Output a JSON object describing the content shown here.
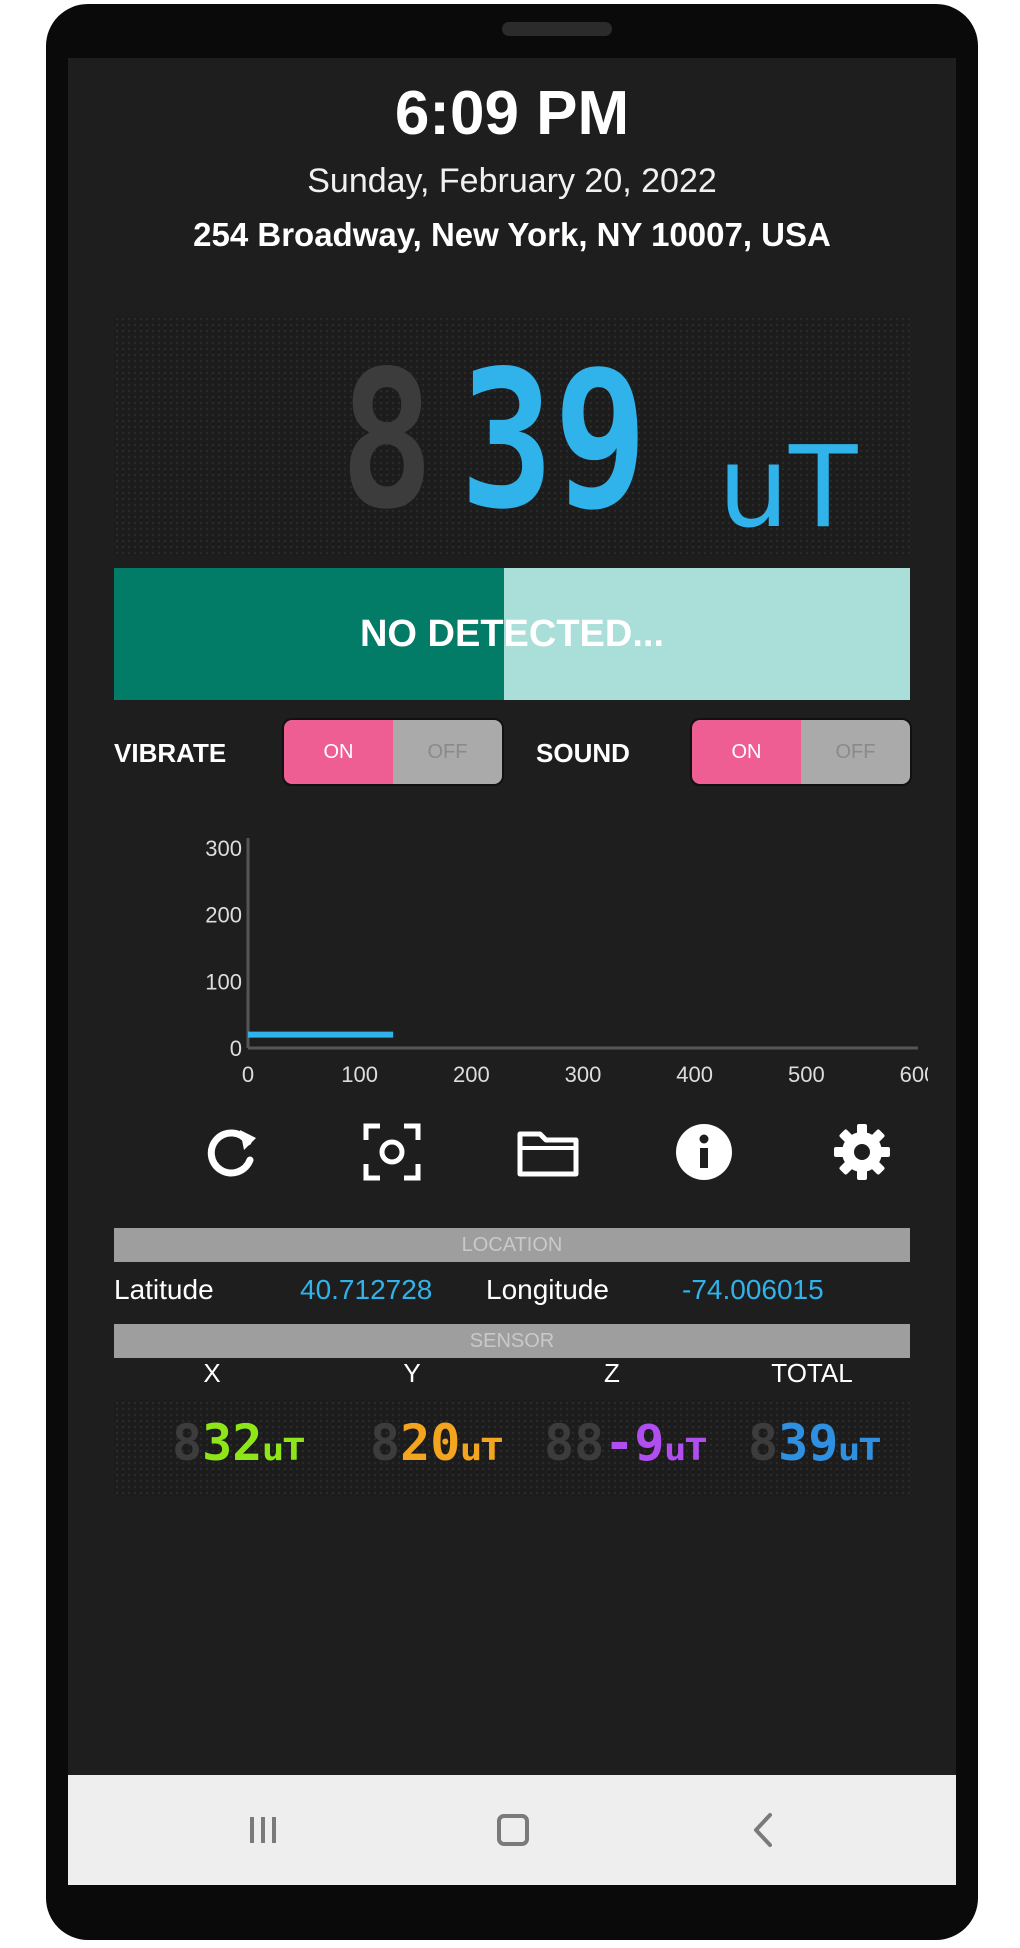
{
  "header": {
    "time": "6:09 PM",
    "date": "Sunday, February 20, 2022",
    "address": "254 Broadway, New York, NY 10007, USA"
  },
  "meter": {
    "ghost_digit": "8",
    "value": "39",
    "unit": "uT",
    "value_color": "#2fb3ea"
  },
  "status": {
    "text": "NO DETECTED...",
    "level_fraction": 0.49,
    "fill_color": "#037c67",
    "track_color": "#a9ded9"
  },
  "toggles": {
    "vibrate": {
      "label": "VIBRATE",
      "on_label": "ON",
      "off_label": "OFF",
      "state": "on"
    },
    "sound": {
      "label": "SOUND",
      "on_label": "ON",
      "off_label": "OFF",
      "state": "on"
    }
  },
  "chart_data": {
    "type": "line",
    "x_ticks": [
      "0",
      "100",
      "200",
      "300",
      "400",
      "500",
      "600"
    ],
    "y_ticks": [
      "0",
      "100",
      "200",
      "300"
    ],
    "xlim": [
      0,
      600
    ],
    "ylim": [
      0,
      300
    ],
    "series": [
      {
        "x": [
          0,
          130
        ],
        "y": [
          20,
          20
        ],
        "color": "#2fb3ea"
      }
    ]
  },
  "toolbar": {
    "icons": [
      "refresh-icon",
      "screenshot-icon",
      "folder-icon",
      "info-icon",
      "settings-icon"
    ]
  },
  "location": {
    "section_title": "LOCATION",
    "latitude_label": "Latitude",
    "latitude_value": "40.712728",
    "longitude_label": "Longitude",
    "longitude_value": "-74.006015"
  },
  "sensor": {
    "section_title": "SENSOR",
    "axes": [
      {
        "label": "X",
        "ghost": "8",
        "value": "32",
        "unit": "uT",
        "color": "#8ee619"
      },
      {
        "label": "Y",
        "ghost": "8",
        "value": "20",
        "unit": "uT",
        "color": "#f3a51f"
      },
      {
        "label": "Z",
        "ghost": "88",
        "value": "-9",
        "unit": "uT",
        "color": "#b04ef0"
      },
      {
        "label": "TOTAL",
        "ghost": "8",
        "value": "39",
        "unit": "uT",
        "color": "#2f8fe0"
      }
    ]
  },
  "navbar": {
    "icons": [
      "recent-apps-icon",
      "home-icon",
      "back-icon"
    ]
  }
}
